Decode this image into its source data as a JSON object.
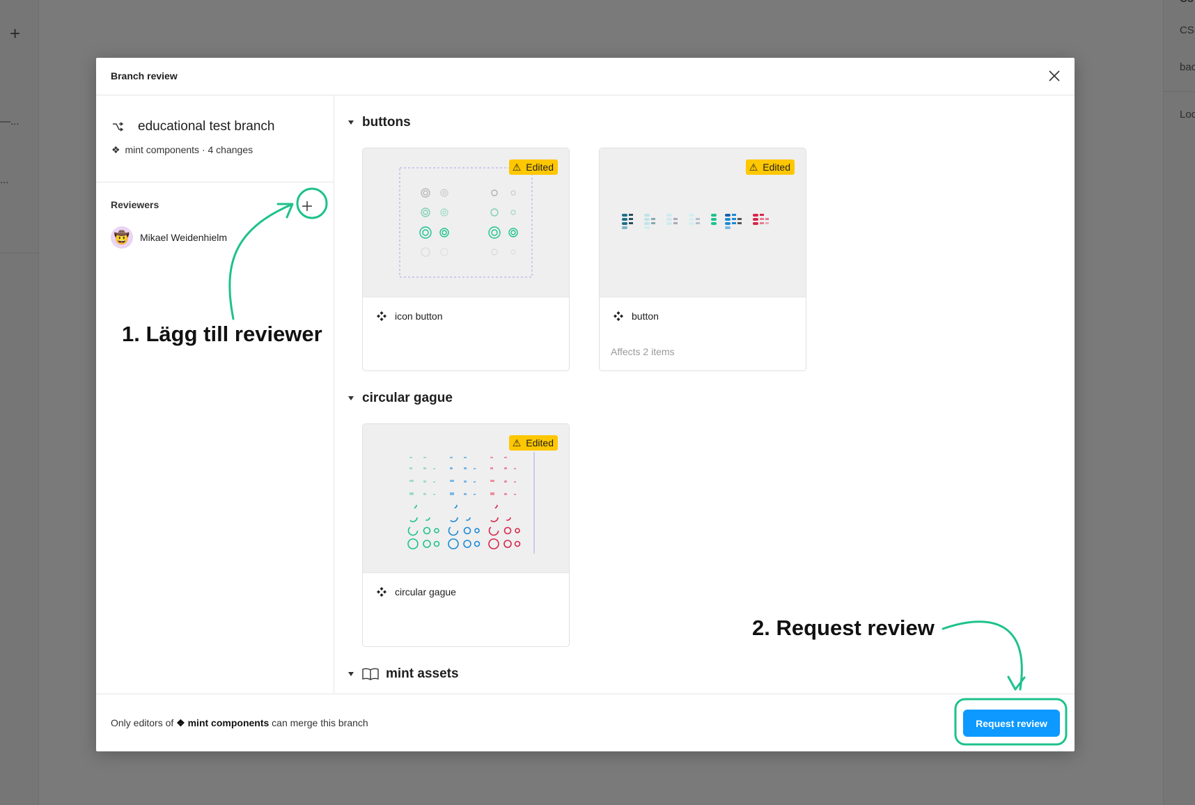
{
  "background": {
    "left_symbols": [
      "+",
      "—...",
      "..."
    ],
    "right_items": [
      "Co",
      "CSS",
      "bac",
      "Loc"
    ]
  },
  "modal": {
    "title": "Branch review",
    "close_icon": "close-icon"
  },
  "branch": {
    "name": "educational test branch",
    "library_symbol": "❖",
    "library": "mint components",
    "changes": "· 4 changes"
  },
  "reviewers": {
    "label": "Reviewers",
    "add_icon": "plus-icon",
    "items": [
      {
        "name": "Mikael Weidenhielm",
        "avatar_emoji": "🤠"
      }
    ]
  },
  "sections": [
    {
      "title": "buttons",
      "cards": [
        {
          "title": "icon button",
          "badge": "Edited",
          "affects": ""
        },
        {
          "title": "button",
          "badge": "Edited",
          "affects": "Affects 2 items"
        }
      ]
    },
    {
      "title": "circular gague",
      "cards": [
        {
          "title": "circular gague",
          "badge": "Edited",
          "affects": ""
        }
      ]
    },
    {
      "title": "mint assets",
      "icon": "book-icon"
    }
  ],
  "footer": {
    "note_prefix": "Only editors of",
    "note_symbol": "❖",
    "note_library": "mint components",
    "note_suffix": "can merge this branch",
    "request_label": "Request review"
  },
  "annotations": {
    "step1": "1. Lägg till reviewer",
    "step2": "2. Request review",
    "color": "#1dc18c"
  },
  "colors": {
    "primary": "#0d99ff",
    "badge": "#ffc700",
    "teal": "#1bc28e",
    "blue": "#1a8ad4",
    "red": "#d6264a"
  }
}
